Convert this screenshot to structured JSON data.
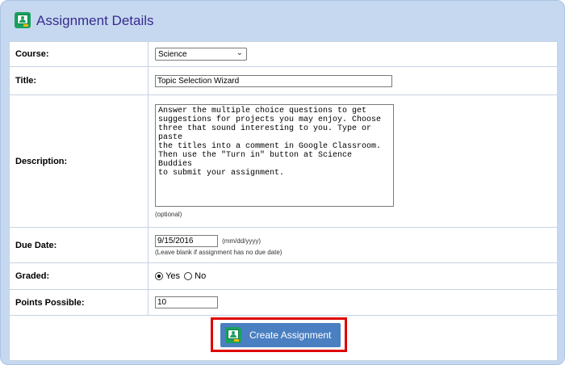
{
  "header": {
    "title": "Assignment Details",
    "icon": "google-classroom-icon"
  },
  "fields": {
    "course": {
      "label": "Course:",
      "value": "Science"
    },
    "title": {
      "label": "Title:",
      "value": "Topic Selection Wizard"
    },
    "description": {
      "label": "Description:",
      "value": "Answer the multiple choice questions to get\nsuggestions for projects you may enjoy. Choose\nthree that sound interesting to you. Type or paste\nthe titles into a comment in Google Classroom.\nThen use the \"Turn in\" button at Science Buddies\nto submit your assignment.",
      "hint": "(optional)"
    },
    "due_date": {
      "label": "Due Date:",
      "value": "9/15/2016",
      "format": "(mm/dd/yyyy)",
      "hint": "(Leave blank if assignment has no due date)"
    },
    "graded": {
      "label": "Graded:",
      "yes": "Yes",
      "no": "No",
      "selected": "Yes"
    },
    "points": {
      "label": "Points Possible:",
      "value": "10"
    }
  },
  "actions": {
    "create_label": "Create Assignment"
  },
  "colors": {
    "panel_bg": "#c5d8f0",
    "button_bg": "#4a7fc1",
    "highlight": "#e00000",
    "title": "#3a2b8f"
  }
}
